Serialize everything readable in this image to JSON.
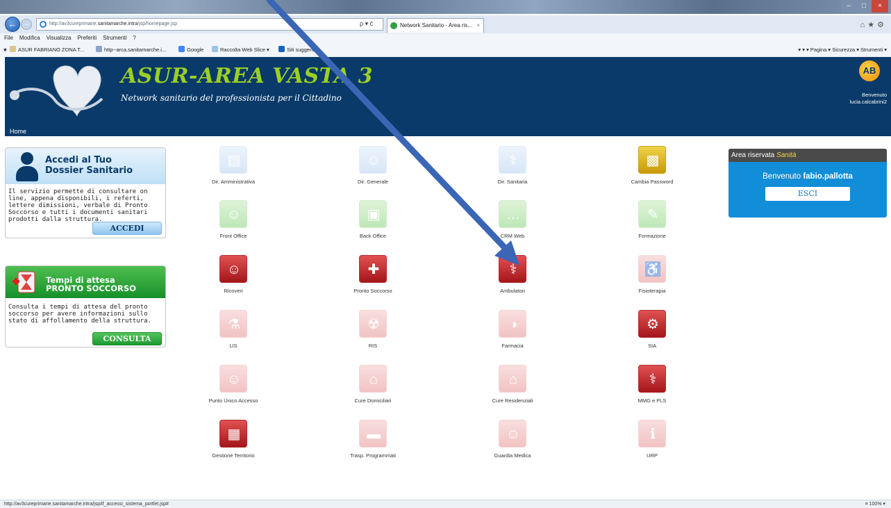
{
  "browser": {
    "url_prefix": "http://av3cureprimarie.",
    "url_host": "sanitamarche.intra",
    "url_path": "/jsp/homepage.jsp",
    "search_glyph": "ρ ▾ č",
    "tab_title": "Network Sanitario - Area ris...",
    "tab_close": "×",
    "menu": [
      "File",
      "Modifica",
      "Visualizza",
      "Preferiti",
      "Strumenti",
      "?"
    ],
    "favorites": [
      "ASUR FABRIANO ZONA T...",
      "http--arca.sanitamarche.i...",
      "Google",
      "Raccolta Web Slice ▾",
      "Siti suggeriti ▾"
    ],
    "command_bar": "▾  ▾  ▾  Pagina ▾  Sicurezza ▾  Strumenti ▾",
    "status_url": "http://av3cureprimarie.sanitamarche.intra/jsp/if_accessi_sistema_portlet.jsp#",
    "zoom": "¤ 100%  ▾"
  },
  "header": {
    "title": "ASUR-AREA VASTA 3",
    "subtitle": "Network sanitario del professionista per il Cittadino",
    "home": "Home",
    "logo_letters": "AB",
    "welcome_line1": "Benvenuto",
    "welcome_line2": "lucia.calcabrini2"
  },
  "dossier_box": {
    "title_line1": "Accedi al Tuo",
    "title_line2": "Dossier Sanitario",
    "text": "Il servizio permette di consultare on line, appena disponibili, i referti, lettere dimissioni, verbale di Pronto Soccorso e tutti i documenti sanitari prodotti dalla struttura.",
    "button": "ACCEDI"
  },
  "ps_box": {
    "title_line1": "Tempi di attesa",
    "title_line2": "PRONTO SOCCORSO",
    "text": "Consulta i tempi di attesa del pronto soccorso per avere informazioni sullo stato di affollamento della struttura.",
    "button": "CONSULTA"
  },
  "area_panel": {
    "head_prefix": "Area riservata ",
    "head_highlight": "Sanità",
    "welcome_prefix": "Benvenuto ",
    "username": "fabio.pallotta",
    "logout": "ESCI"
  },
  "tiles": [
    {
      "label": "Dir. Amministrativa",
      "style": "blue",
      "glyph": "▤",
      "icon": "folder-icon"
    },
    {
      "label": "Dir. Generale",
      "style": "blue",
      "glyph": "☺",
      "icon": "manager-icon"
    },
    {
      "label": "Dir. Sanitaria",
      "style": "blue",
      "glyph": "⚕",
      "icon": "doctor-icon"
    },
    {
      "label": "Cambia Password",
      "style": "yellow",
      "glyph": "▩",
      "icon": "padlock-icon"
    },
    {
      "label": "Front Office",
      "style": "green",
      "glyph": "☺",
      "icon": "receptionist-icon"
    },
    {
      "label": "Back Office",
      "style": "green",
      "glyph": "▣",
      "icon": "computer-icon"
    },
    {
      "label": "CRM Web",
      "style": "green",
      "glyph": "…",
      "icon": "chat-icon"
    },
    {
      "label": "Formazione",
      "style": "green",
      "glyph": "✎",
      "icon": "pencil-icon"
    },
    {
      "label": "Ricoveri",
      "style": "red",
      "glyph": "☺",
      "icon": "hospitalization-icon"
    },
    {
      "label": "Pronto Soccorso",
      "style": "red",
      "glyph": "✚",
      "icon": "first-aid-kit-icon"
    },
    {
      "label": "Ambulatori",
      "style": "red",
      "glyph": "⚕",
      "icon": "clinic-doctor-icon"
    },
    {
      "label": "Fisioterapia",
      "style": "pink",
      "glyph": "♿",
      "icon": "physiotherapy-icon"
    },
    {
      "label": "LIS",
      "style": "pink",
      "glyph": "⚗",
      "icon": "lab-flask-icon"
    },
    {
      "label": "RIS",
      "style": "pink",
      "glyph": "☢",
      "icon": "radiation-icon"
    },
    {
      "label": "Farmacia",
      "style": "pink",
      "glyph": "◑",
      "icon": "pill-icon"
    },
    {
      "label": "SIA",
      "style": "red",
      "glyph": "⚙",
      "icon": "gears-icon"
    },
    {
      "label": "Punto Unico Accesso",
      "style": "pink",
      "glyph": "☺",
      "icon": "people-icon"
    },
    {
      "label": "Cure Domiciliari",
      "style": "pink",
      "glyph": "⌂",
      "icon": "home-care-icon"
    },
    {
      "label": "Cure Residenziali",
      "style": "pink",
      "glyph": "⌂",
      "icon": "residence-icon"
    },
    {
      "label": "MMG e PLS",
      "style": "red",
      "glyph": "⚕",
      "icon": "general-practitioner-icon"
    },
    {
      "label": "Gestione Territorio",
      "style": "red",
      "glyph": "▦",
      "icon": "territory-map-icon"
    },
    {
      "label": "Trasp. Programmati",
      "style": "pink",
      "glyph": "▬",
      "icon": "ambulance-icon"
    },
    {
      "label": "Guardia Medica",
      "style": "pink",
      "glyph": "☺",
      "icon": "on-call-doctor-icon"
    },
    {
      "label": "URP",
      "style": "pink",
      "glyph": "ℹ",
      "icon": "info-icon"
    }
  ]
}
